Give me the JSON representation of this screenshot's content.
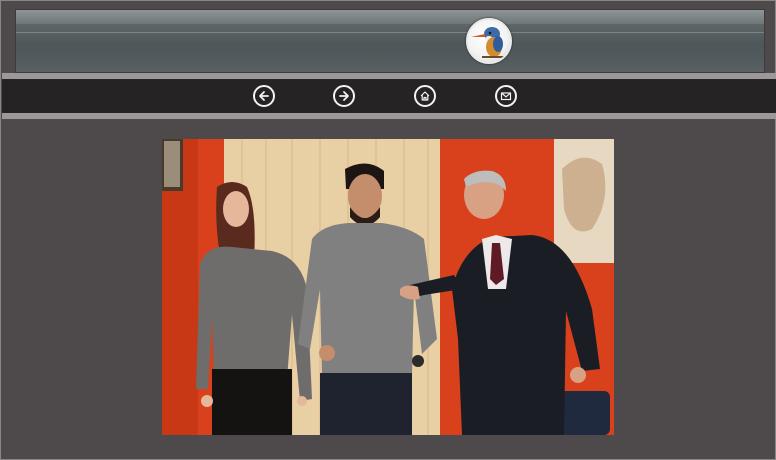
{
  "banner": {
    "logo_icon": "kingfisher-logo-icon"
  },
  "nav": {
    "items": [
      {
        "icon": "arrow-left-icon",
        "name": "back"
      },
      {
        "icon": "arrow-right-icon",
        "name": "forward"
      },
      {
        "icon": "home-icon",
        "name": "home"
      },
      {
        "icon": "mail-icon",
        "name": "mail"
      }
    ]
  },
  "photo": {
    "subject": "three-people-photo",
    "colors": {
      "wall": "#d9411c",
      "panel": "#e9cfa4",
      "background": "#4e4a4b"
    }
  }
}
